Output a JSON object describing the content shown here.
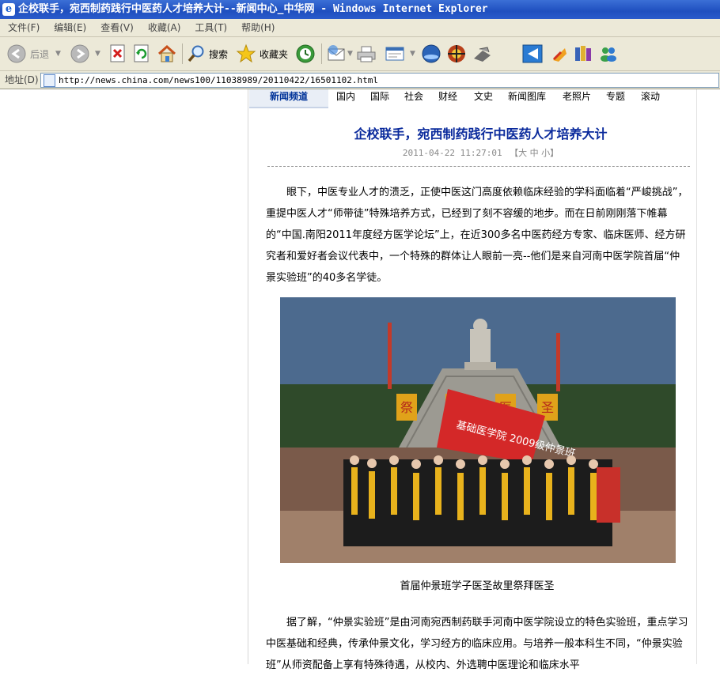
{
  "window": {
    "title": "企校联手，宛西制药践行中医药人才培养大计--新闻中心_中华网 - Windows Internet Explorer"
  },
  "menu": [
    "文件(F)",
    "编辑(E)",
    "查看(V)",
    "收藏(A)",
    "工具(T)",
    "帮助(H)"
  ],
  "toolbar": {
    "back_label": "后退",
    "search_label": "搜索",
    "favorites_label": "收藏夹"
  },
  "address": {
    "label": "地址(D)",
    "url": "http://news.china.com/news100/11038989/20110422/16501102.html"
  },
  "nav": {
    "active": "新闻频道",
    "items": [
      "国内",
      "国际",
      "社会",
      "财经",
      "文史",
      "新闻图库",
      "老照片",
      "专题",
      "滚动"
    ]
  },
  "article": {
    "title": "企校联手，宛西制药践行中医药人才培养大计",
    "timestamp": "2011-04-22 11:27:01",
    "font_size_options": "【大 中 小】",
    "paragraph1": "眼下，中医专业人才的溃乏，正使中医这门高度依赖临床经验的学科面临着“严峻挑战”，重提中医人才“师带徒”特殊培养方式，已经到了刻不容缓的地步。而在日前刚刚落下帷幕的“中国.南阳2011年度经方医学论坛”上，在近300多名中医药经方专家、临床医师、经方研究者和爱好者会议代表中，一个特殊的群体让人眼前一亮--他们是来自河南中医学院首届“仲景实验班”的40多名学徒。",
    "photo_banner_text": "基础医学院 2009级仲景班",
    "photo_plaque_texts": [
      "祭",
      "医",
      "圣"
    ],
    "photo_caption": "首届仲景班学子医圣故里祭拜医圣",
    "paragraph2": "据了解，“仲景实验班”是由河南宛西制药联手河南中医学院设立的特色实验班，重点学习中医基础和经典，传承仲景文化，学习经方的临床应用。与培养一般本科生不同，“仲景实验班”从师资配备上享有特殊待遇，从校内、外选聘中医理论和临床水平"
  },
  "colors": {
    "titlebar": "#2a5bcb",
    "chrome": "#ece9d8",
    "headline": "#0a2a9c",
    "nav_active": "#003399",
    "banner_red": "#d42828",
    "sash_yellow": "#e8b21c"
  }
}
